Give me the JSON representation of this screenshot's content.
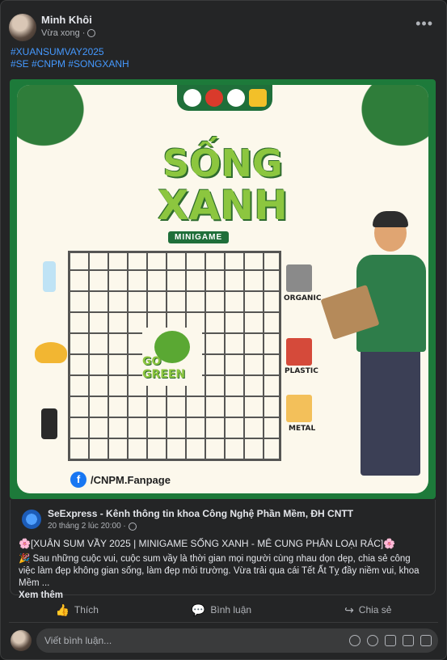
{
  "post": {
    "author": "Minh Khôi",
    "time": "Vừa xong",
    "more_icon": "more-horizontal-icon",
    "hashtags": [
      "#XUANSUMVAY2025",
      "#SE #CNPM #SONGXANH"
    ]
  },
  "image": {
    "title_line1": "SỐNG",
    "title_line2": "XANH",
    "badge": "MINIGAME",
    "center_text": "GO GREEN",
    "bins": [
      "ORGANIC",
      "PLASTIC",
      "METAL"
    ],
    "fanpage": "/CNPM.Fanpage"
  },
  "shared": {
    "source_name": "SeExpress - Kênh thông tin khoa Công Nghệ Phần Mềm, ĐH CNTT",
    "source_time": "20 tháng 2 lúc 20:00 ·",
    "title": "🌸[XUÂN SUM VẦY 2025 | MINIGAME SỐNG XANH - MÊ CUNG PHÂN LOẠI RÁC]🌸",
    "body": "🎉 Sau những cuộc vui, cuộc sum vầy là thời gian mọi người cùng nhau dọn dẹp, chia sẻ công việc làm đẹp không gian sống, làm đẹp môi trường. Vừa trải qua cái Tết Ất Tỵ đầy niềm vui, khoa Mềm ...",
    "see_more": "Xem thêm"
  },
  "actions": {
    "like": "Thích",
    "comment": "Bình luận",
    "share": "Chia sẻ"
  },
  "comment_box": {
    "placeholder": "Viết bình luận..."
  }
}
